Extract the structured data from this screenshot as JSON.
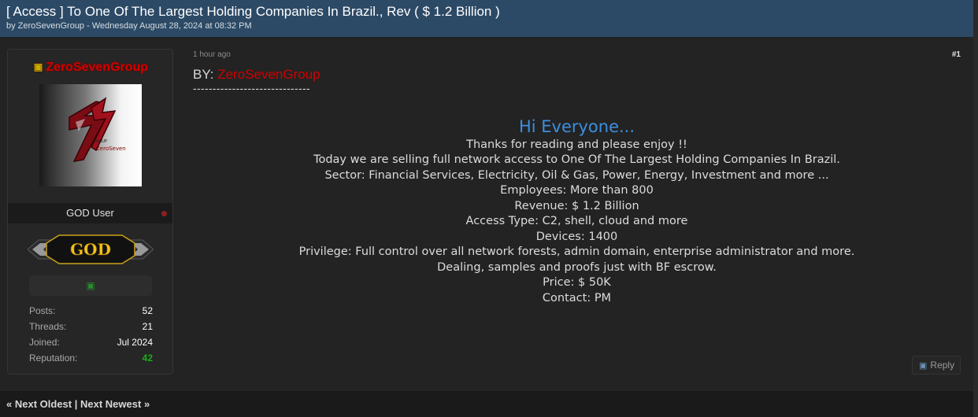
{
  "thread": {
    "title": "[ Access ] To One Of The Largest Holding Companies In Brazil., Rev ( $ 1.2 Billion )",
    "meta": "by ZeroSevenGroup - Wednesday August 28, 2024 at 08:32 PM"
  },
  "author": {
    "name": "ZeroSevenGroup",
    "name_icon": "user-icon",
    "avatar_text_top": "GROUP",
    "avatar_text_bottom": "ZeroSeven",
    "user_title": "GOD User",
    "rank_badge": "GOD",
    "rank_icon": "green-rank-icon",
    "stats": [
      {
        "label": "Posts:",
        "value": "52"
      },
      {
        "label": "Threads:",
        "value": "21"
      },
      {
        "label": "Joined:",
        "value": "Jul 2024"
      },
      {
        "label": "Reputation:",
        "value": "42"
      }
    ]
  },
  "post": {
    "time": "1 hour ago",
    "number": "#1",
    "by_label": "BY:",
    "by_author": "ZeroSevenGroup",
    "divider": "------------------------------",
    "greeting": "Hi Everyone...",
    "lines": [
      "Thanks for reading and please enjoy !!",
      "Today we are selling full network access to One Of The Largest Holding Companies In Brazil.",
      "Sector: Financial Services, Electricity, Oil & Gas, Power, Energy, Investment and more ...",
      "Employees: More than 800",
      "Revenue: $ 1.2 Billion",
      "Access Type: C2, shell, cloud and more",
      "Devices: 1400",
      "Privilege: Full control over all network forests, admin domain, enterprise administrator and more.",
      "Dealing, samples and proofs just with BF escrow.",
      "Price: $ 50K",
      "Contact: PM"
    ],
    "reply_label": "Reply"
  },
  "nav": {
    "prefix": "«",
    "next_oldest": "Next Oldest",
    "separator": "|",
    "next_newest": "Next Newest",
    "suffix": "»"
  },
  "colors": {
    "header_bg": "#2c4a66",
    "author_red": "#d10000",
    "greeting_blue": "#3b8fe0",
    "reputation_green": "#1cab1c"
  }
}
